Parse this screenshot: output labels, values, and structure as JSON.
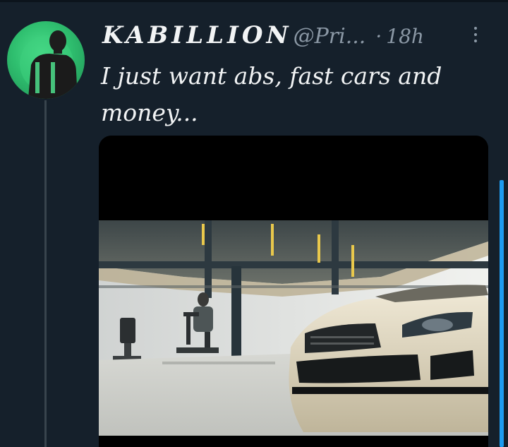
{
  "tweet": {
    "display_name": "KABILLION",
    "handle": "@Pri...",
    "separator": "·",
    "time": "18h",
    "text": "I just want abs, fast cars and money...",
    "avatar": "avatar-silhouette-green",
    "more_icon": "more-vertical-icon",
    "media": "video-garage-car-gym"
  },
  "colors": {
    "background": "#15202b",
    "text": "#e7e9ea",
    "secondary": "#8b98a5",
    "avatar_green": "#2fbf6f",
    "accent_scroll": "#1d9bf0"
  }
}
